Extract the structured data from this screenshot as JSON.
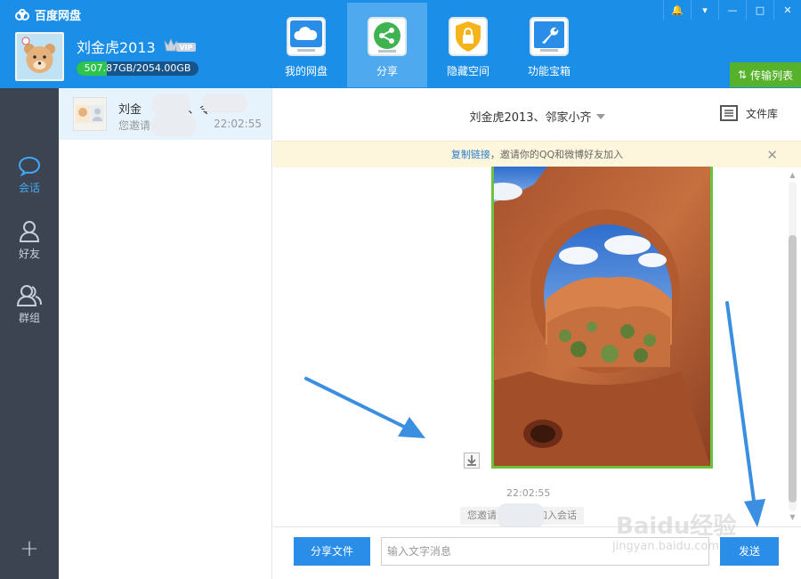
{
  "app": {
    "title": "百度网盘"
  },
  "user": {
    "name": "刘金虎2013",
    "vip_label": "VIP",
    "storage_text": "507.87GB/2054.00GB",
    "storage_used_fraction": 0.247
  },
  "nav": {
    "tabs": [
      {
        "label": "我的网盘",
        "icon": "cloud-drive-icon",
        "active": false
      },
      {
        "label": "分享",
        "icon": "share-icon",
        "active": true
      },
      {
        "label": "隐藏空间",
        "icon": "lock-icon",
        "active": false
      },
      {
        "label": "功能宝箱",
        "icon": "wrench-icon",
        "active": false
      }
    ]
  },
  "window_controls": {
    "notify": "🔔",
    "menu": "▾",
    "minimize": "—",
    "maximize": "□",
    "close": "✕"
  },
  "transfer": {
    "label": "传输列表"
  },
  "rail": {
    "items": [
      {
        "label": "会话",
        "icon": "chat-bubble-icon",
        "active": true
      },
      {
        "label": "好友",
        "icon": "person-icon",
        "active": false
      },
      {
        "label": "群组",
        "icon": "group-icon",
        "active": false
      }
    ],
    "add_label": "+"
  },
  "sessions": [
    {
      "name": "刘金",
      "name_tail": "3、令",
      "preview": "您邀请",
      "time": "22:02:55"
    }
  ],
  "chat": {
    "title": "刘金虎2013、邻家小齐",
    "file_library": "文件库",
    "notice": {
      "link": "复制链接",
      "text": "，邀请你的QQ和微博好友加入",
      "close": "✕"
    },
    "message_time": "22:02:55",
    "system_msg_prefix": "您邀请",
    "system_msg_suffix": "加入会话"
  },
  "input_bar": {
    "share_file": "分享文件",
    "placeholder": "输入文字消息",
    "send": "发送"
  },
  "watermark": {
    "title": "Baidu经验",
    "sub": "jingyan.baidu.com"
  },
  "colors": {
    "header": "#1b8ee8",
    "rail": "#3c4451",
    "accent": "#2a8ee8",
    "transfer": "#56b12b",
    "image_border": "#6cc23e",
    "annotation_arrow": "#3b8fe0"
  }
}
